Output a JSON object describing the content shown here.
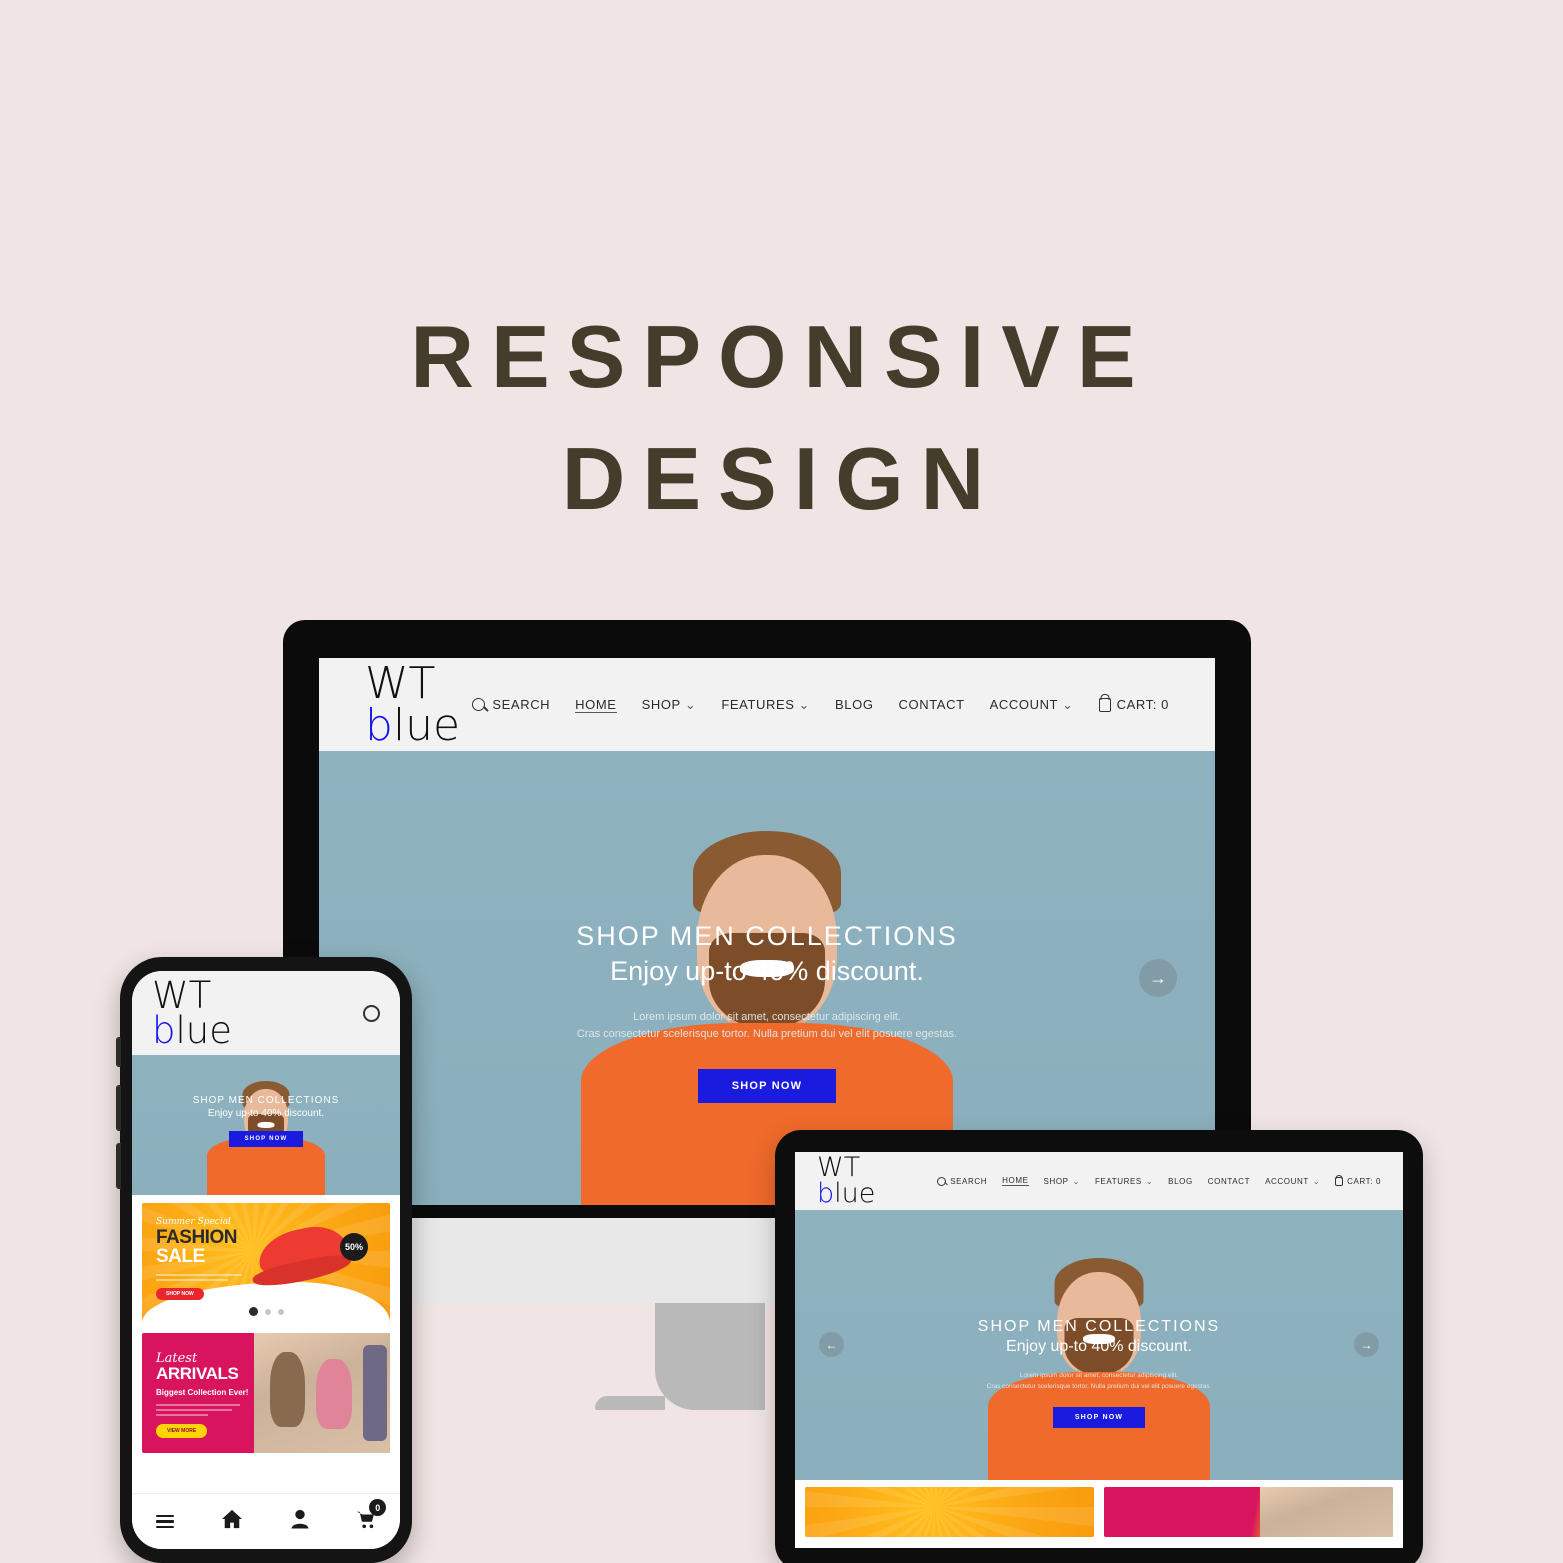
{
  "poster": {
    "title_line1": "RESPONSIVE",
    "title_line2": "DESIGN",
    "background_color": "#f0e5e4",
    "title_color": "#453d2c"
  },
  "brand": {
    "logo_top": "WT",
    "logo_bottom_b": "b",
    "logo_bottom_rest": "lue",
    "accent_color": "#1414ee"
  },
  "nav": {
    "search": "SEARCH",
    "home": "HOME",
    "shop": "SHOP",
    "features": "FEATURES",
    "blog": "BLOG",
    "contact": "CONTACT",
    "account": "ACCOUNT",
    "cart_label": "CART:",
    "cart_count": "0",
    "caret": "⌄"
  },
  "hero": {
    "title": "SHOP MEN COLLECTIONS",
    "subtitle": "Enjoy up-to 40% discount.",
    "body_line1": "Lorem ipsum dolor sit amet, consectetur adipiscing elit.",
    "body_line2": "Cras consectetur scelerisque tortor. Nulla pretium dui vel elit posuere egestas.",
    "cta": "SHOP NOW",
    "arrow_next": "→",
    "arrow_prev": "←",
    "bg_color": "#8cb0bd",
    "cta_color": "#1b1be0"
  },
  "promo_fashion": {
    "eyebrow": "Summer Special",
    "title_line1": "FASHION",
    "title_line2": "SALE",
    "cta": "SHOP NOW",
    "badge": "50%",
    "bg_color": "#fca613",
    "dots_total": 3,
    "dots_active": 1
  },
  "promo_arrivals": {
    "eyebrow": "Latest",
    "title": "ARRIVALS",
    "subtitle": "Biggest Collection Ever!",
    "cta": "VIEW MORE",
    "bg_color": "#d8145e"
  },
  "mobile_tabbar": {
    "menu": "menu",
    "home": "home",
    "account": "account",
    "cart": "cart",
    "cart_count": "0"
  }
}
